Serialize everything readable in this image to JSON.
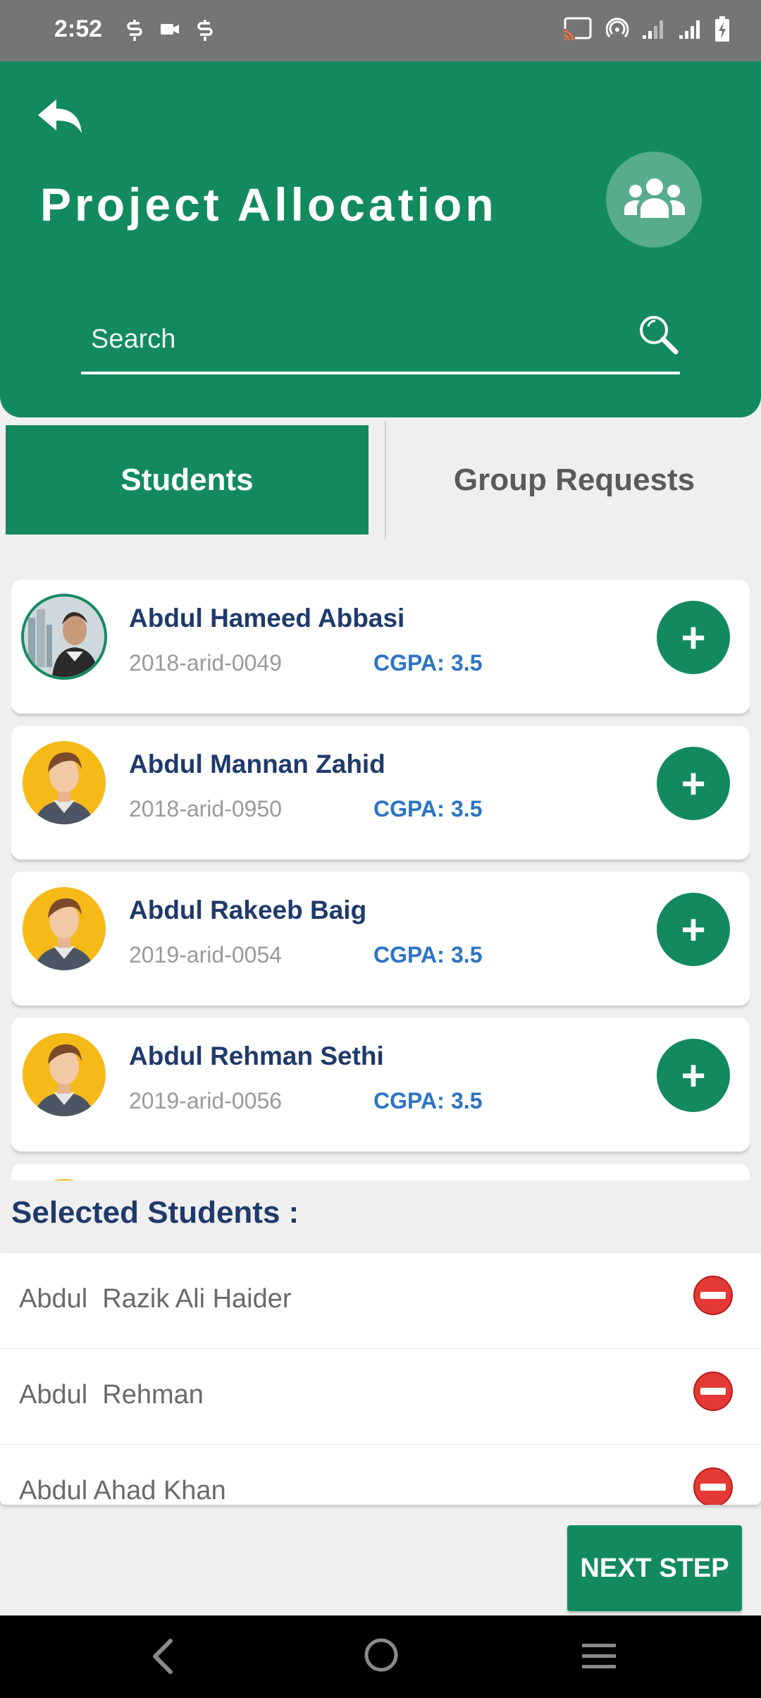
{
  "status_bar": {
    "time": "2:52"
  },
  "header": {
    "title": "Project Allocation",
    "search_placeholder": "Search"
  },
  "tabs": [
    {
      "label": "Students",
      "active": true
    },
    {
      "label": "Group Requests",
      "active": false
    }
  ],
  "students": [
    {
      "name": "Abdul Hameed Abbasi",
      "id": "2018-arid-0049",
      "cgpa_label": "CGPA:",
      "cgpa": "3.5",
      "avatar": "photo"
    },
    {
      "name": "Abdul Mannan Zahid",
      "id": "2018-arid-0950",
      "cgpa_label": "CGPA:",
      "cgpa": "3.5",
      "avatar": "default-avatar"
    },
    {
      "name": "Abdul Rakeeb Baig",
      "id": "2019-arid-0054",
      "cgpa_label": "CGPA:",
      "cgpa": "3.5",
      "avatar": "default-avatar"
    },
    {
      "name": "Abdul Rehman Sethi",
      "id": "2019-arid-0056",
      "cgpa_label": "CGPA:",
      "cgpa": "3.5",
      "avatar": "default-avatar"
    }
  ],
  "selected": {
    "title": "Selected Students :",
    "items": [
      {
        "name": "Abdul  Razik Ali Haider"
      },
      {
        "name": "Abdul  Rehman"
      },
      {
        "name": "Abdul Ahad Khan"
      }
    ]
  },
  "next_button": "NEXT STEP",
  "colors": {
    "primary": "#138a5e",
    "name_text": "#1f3a6b",
    "cgpa": "#2d74c4",
    "remove": "#e53935"
  }
}
